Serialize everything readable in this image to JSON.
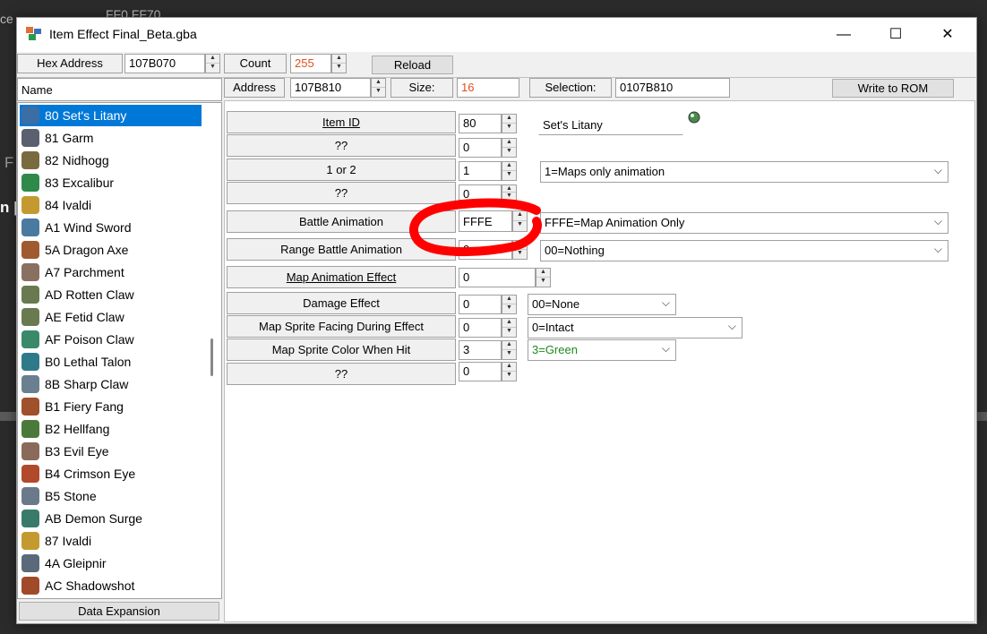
{
  "background": {
    "left_fragment_1": "ce",
    "top_fragment": "FF0   FF70",
    "left_fragment_2": "F",
    "left_fragment_3": "n |"
  },
  "window": {
    "title": "Item Effect Final_Beta.gba",
    "minimize_glyph": "—",
    "maximize_glyph": "☐",
    "close_glyph": "✕"
  },
  "toolbar1": {
    "hex_address_label": "Hex Address",
    "hex_address_value": "107B070",
    "count_label": "Count",
    "count_value": "255",
    "reload_label": "Reload"
  },
  "toolbar2": {
    "name_header": "Name",
    "address_label": "Address",
    "address_value": "107B810",
    "size_label": "Size:",
    "size_value": "16",
    "selection_label": "Selection:",
    "selection_value": "0107B810",
    "write_label": "Write to ROM"
  },
  "list": {
    "items": [
      {
        "label": "80 Set's Litany",
        "color": "#3a6ea5",
        "icon": "orb-icon"
      },
      {
        "label": "81 Garm",
        "color": "#5a6070",
        "icon": "claw-icon"
      },
      {
        "label": "82 Nidhogg",
        "color": "#7a6a40",
        "icon": "bow-icon"
      },
      {
        "label": "83 Excalibur",
        "color": "#2f8a4a",
        "icon": "tome-icon"
      },
      {
        "label": "84 Ivaldi",
        "color": "#c49a30",
        "icon": "tome-icon"
      },
      {
        "label": "A1 Wind Sword",
        "color": "#4a7aa0",
        "icon": "sword-icon"
      },
      {
        "label": "5A Dragon Axe",
        "color": "#a05a30",
        "icon": "axe-icon"
      },
      {
        "label": "A7 Parchment",
        "color": "#8a7060",
        "icon": "scroll-icon"
      },
      {
        "label": "AD Rotten Claw",
        "color": "#6a7a50",
        "icon": "claw-icon"
      },
      {
        "label": "AE Fetid Claw",
        "color": "#6a7a50",
        "icon": "claw-icon"
      },
      {
        "label": "AF Poison Claw",
        "color": "#3a8a6a",
        "icon": "claw-icon"
      },
      {
        "label": "B0 Lethal Talon",
        "color": "#2f7a8a",
        "icon": "claw-icon"
      },
      {
        "label": "8B Sharp Claw",
        "color": "#6a8090",
        "icon": "claw-icon"
      },
      {
        "label": "B1 Fiery Fang",
        "color": "#a0502a",
        "icon": "fang-icon"
      },
      {
        "label": "B2 Hellfang",
        "color": "#4a7a3a",
        "icon": "fang-icon"
      },
      {
        "label": "B3 Evil Eye",
        "color": "#8a6a5a",
        "icon": "eye-icon"
      },
      {
        "label": "B4 Crimson Eye",
        "color": "#b04a2a",
        "icon": "eye-icon"
      },
      {
        "label": "B5 Stone",
        "color": "#6a7a8a",
        "icon": "stone-icon"
      },
      {
        "label": "AB Demon Surge",
        "color": "#3a7a6a",
        "icon": "surge-icon"
      },
      {
        "label": "87 Ivaldi",
        "color": "#c49a30",
        "icon": "tome-icon"
      },
      {
        "label": "4A Gleipnir",
        "color": "#5a6a7a",
        "icon": "tome-icon"
      },
      {
        "label": "AC Shadowshot",
        "color": "#a04a2a",
        "icon": "shadow-icon"
      }
    ],
    "footer_button": "Data Expansion"
  },
  "fields": {
    "item_id": {
      "label": "Item ID",
      "value": "80",
      "name_value": "Set's Litany"
    },
    "unk1": {
      "label": "??",
      "value": "0"
    },
    "one_or_two": {
      "label": "1 or 2",
      "value": "1",
      "combo": "1=Maps only animation"
    },
    "unk2": {
      "label": "??",
      "value": "0"
    },
    "battle_animation": {
      "label": "Battle Animation",
      "value": "FFFE",
      "combo": "FFFE=Map Animation Only"
    },
    "range_battle_animation": {
      "label": "Range Battle Animation",
      "value": "0",
      "combo": "00=Nothing"
    },
    "map_animation_effect": {
      "label": "Map Animation Effect",
      "value": "0"
    },
    "damage_effect": {
      "label": "Damage Effect",
      "value": "0",
      "combo": "00=None"
    },
    "map_sprite_facing": {
      "label": "Map Sprite Facing During Effect",
      "value": "0",
      "combo": "0=Intact"
    },
    "map_sprite_color": {
      "label": "Map Sprite Color When Hit",
      "value": "3",
      "combo": "3=Green"
    },
    "unk3": {
      "label": "??",
      "value": "0"
    }
  },
  "colors": {
    "accent": "#0078d7",
    "count_text": "#e0501e",
    "green_text": "#1e8a1e",
    "annotation": "#ff0000"
  },
  "icons": {
    "up": "▲",
    "down": "▼",
    "chevron": "⌵"
  }
}
